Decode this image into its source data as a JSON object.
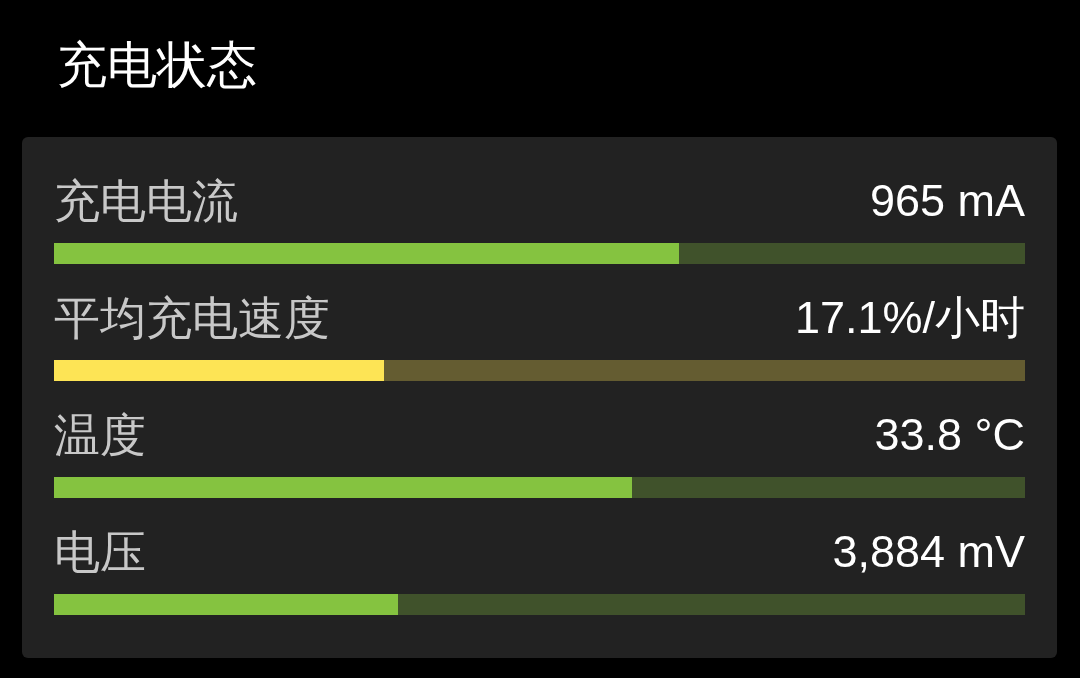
{
  "title": "充电状态",
  "meters": [
    {
      "label": "充电电流",
      "value": "965 mA",
      "level": 0.644,
      "color": "#85c340"
    },
    {
      "label": "平均充电速度",
      "value": "17.1%/小时",
      "level": 0.34,
      "color": "#fde455"
    },
    {
      "label": "温度",
      "value": "33.8 °C",
      "level": 0.595,
      "color": "#85c340"
    },
    {
      "label": "电压",
      "value": "3,884 mV",
      "level": 0.354,
      "color": "#85c340"
    }
  ]
}
